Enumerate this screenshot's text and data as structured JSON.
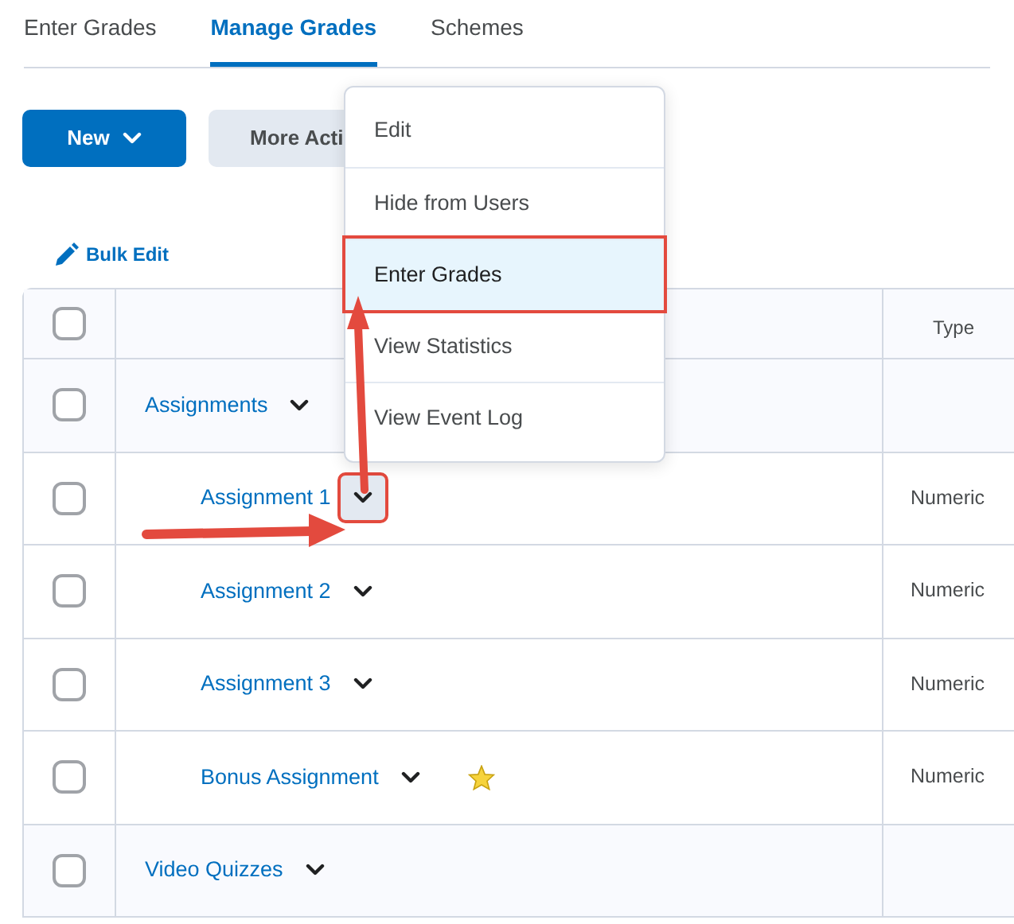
{
  "tabs": [
    {
      "label": "Enter Grades",
      "selected": false
    },
    {
      "label": "Manage Grades",
      "selected": true
    },
    {
      "label": "Schemes",
      "selected": false
    }
  ],
  "toolbar": {
    "new_button": "New",
    "more_button": "More Acti"
  },
  "bulk_edit": "Bulk Edit",
  "table": {
    "columns": [
      "Type"
    ],
    "select_all_checked": false,
    "rows": [
      {
        "kind": "category",
        "name": "Assignments",
        "checked": false,
        "menu_open": false,
        "starred": false
      },
      {
        "kind": "item",
        "name": "Assignment 1",
        "type": "Numeric",
        "checked": false,
        "menu_open": true,
        "starred": false
      },
      {
        "kind": "item",
        "name": "Assignment 2",
        "type": "Numeric",
        "checked": false,
        "menu_open": false,
        "starred": false
      },
      {
        "kind": "item",
        "name": "Assignment 3",
        "type": "Numeric",
        "checked": false,
        "menu_open": false,
        "starred": false
      },
      {
        "kind": "item",
        "name": "Bonus Assignment",
        "type": "Numeric",
        "checked": false,
        "menu_open": false,
        "starred": true
      },
      {
        "kind": "category",
        "name": "Video Quizzes",
        "checked": false,
        "menu_open": false,
        "starred": false
      }
    ]
  },
  "menu": {
    "items": [
      {
        "label": "Edit",
        "selected": false
      },
      {
        "label": "Hide from Users",
        "selected": false
      },
      {
        "label": "Enter Grades",
        "selected": true
      },
      {
        "label": "View Statistics",
        "selected": false
      },
      {
        "label": "View Event Log",
        "selected": false
      }
    ]
  }
}
